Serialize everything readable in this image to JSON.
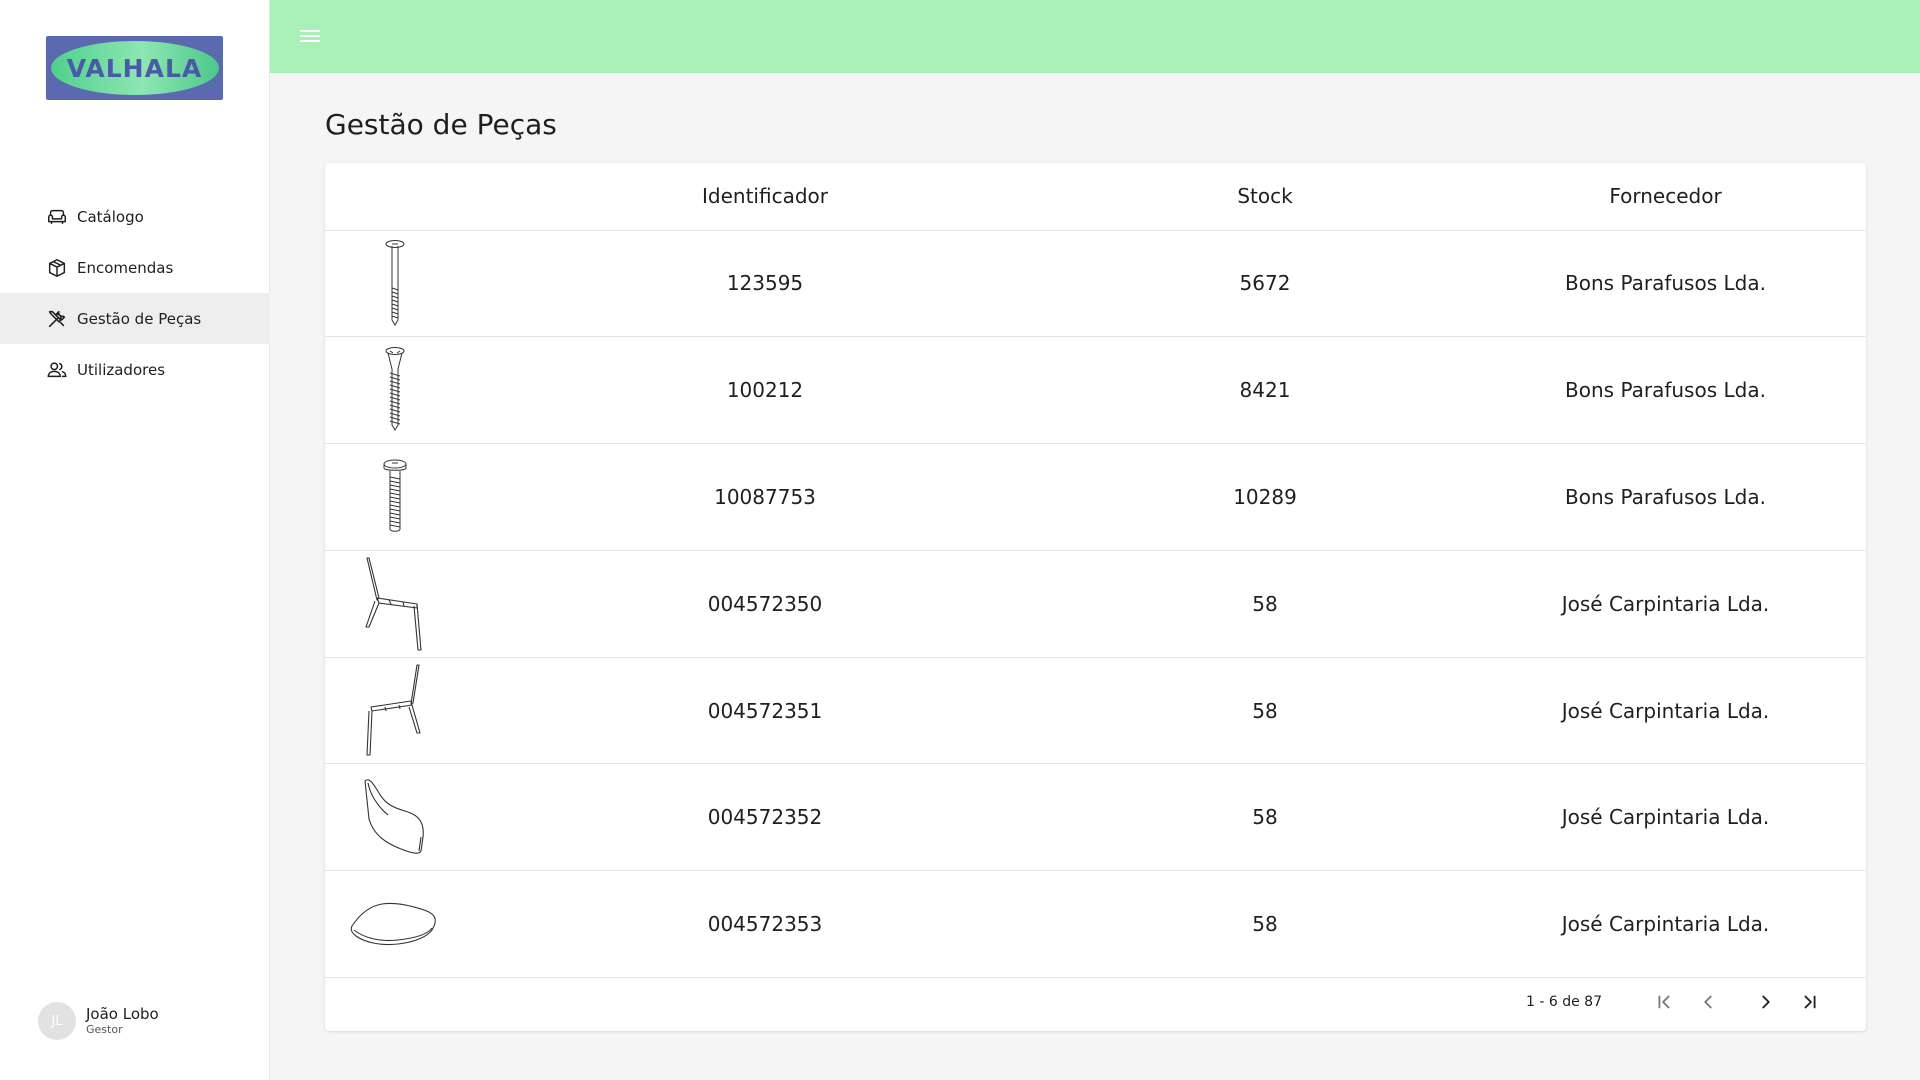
{
  "brand": {
    "logo_text": "VALHALA"
  },
  "sidebar": {
    "items": [
      {
        "label": "Catálogo",
        "icon": "sofa-icon",
        "active": false
      },
      {
        "label": "Encomendas",
        "icon": "box-icon",
        "active": false
      },
      {
        "label": "Gestão de Peças",
        "icon": "tools-icon",
        "active": true
      },
      {
        "label": "Utilizadores",
        "icon": "users-icon",
        "active": false
      }
    ]
  },
  "user": {
    "initials": "JL",
    "name": "João Lobo",
    "role": "Gestor"
  },
  "topbar": {
    "menu_icon": "hamburger-menu-icon",
    "color": "#a8f0b8"
  },
  "page": {
    "title": "Gestão de Peças"
  },
  "table": {
    "columns": [
      "",
      "Identificador",
      "Stock",
      "Fornecedor"
    ],
    "rows": [
      {
        "image": "screw-long-icon",
        "id": "123595",
        "stock": "5672",
        "supplier": "Bons Parafusos Lda."
      },
      {
        "image": "screw-wood-icon",
        "id": "100212",
        "stock": "8421",
        "supplier": "Bons Parafusos Lda."
      },
      {
        "image": "bolt-icon",
        "id": "10087753",
        "stock": "10289",
        "supplier": "Bons Parafusos Lda."
      },
      {
        "image": "chair-frame-left-icon",
        "id": "004572350",
        "stock": "58",
        "supplier": "José Carpintaria Lda."
      },
      {
        "image": "chair-frame-right-icon",
        "id": "004572351",
        "stock": "58",
        "supplier": "José Carpintaria Lda."
      },
      {
        "image": "chair-backrest-icon",
        "id": "004572352",
        "stock": "58",
        "supplier": "José Carpintaria Lda."
      },
      {
        "image": "chair-seat-icon",
        "id": "004572353",
        "stock": "58",
        "supplier": "José Carpintaria Lda."
      }
    ]
  },
  "paginator": {
    "range_label": "1 - 6 de 87"
  }
}
